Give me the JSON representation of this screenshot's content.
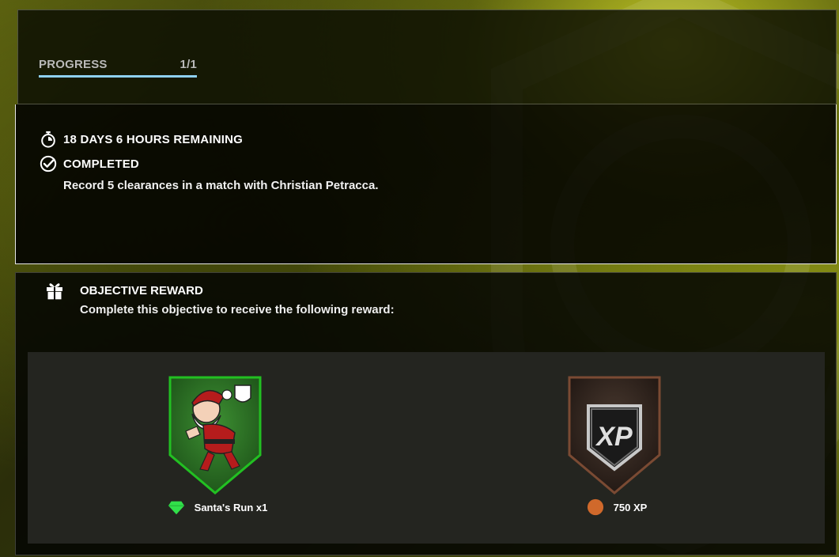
{
  "progress": {
    "label": "PROGRESS",
    "count": "1/1",
    "fraction": 1.0
  },
  "status": {
    "time_remaining": "18 DAYS 6 HOURS REMAINING",
    "state": "COMPLETED",
    "description": "Record 5 clearances in a match with Christian Petracca."
  },
  "reward": {
    "title": "OBJECTIVE REWARD",
    "subtitle": "Complete this objective to receive the following reward:",
    "items": [
      {
        "name": "Santa's Run x1",
        "marker_icon": "green-gem-icon",
        "badge_icon": "santa-badge-icon",
        "accent": "#2fb52f"
      },
      {
        "name": "750 XP",
        "marker_icon": "orange-circle-icon",
        "badge_icon": "xp-badge-icon",
        "accent": "#d0692b"
      }
    ]
  },
  "colors": {
    "progress_fill": "#8fd1f5",
    "background_accent": "#c8d020"
  }
}
